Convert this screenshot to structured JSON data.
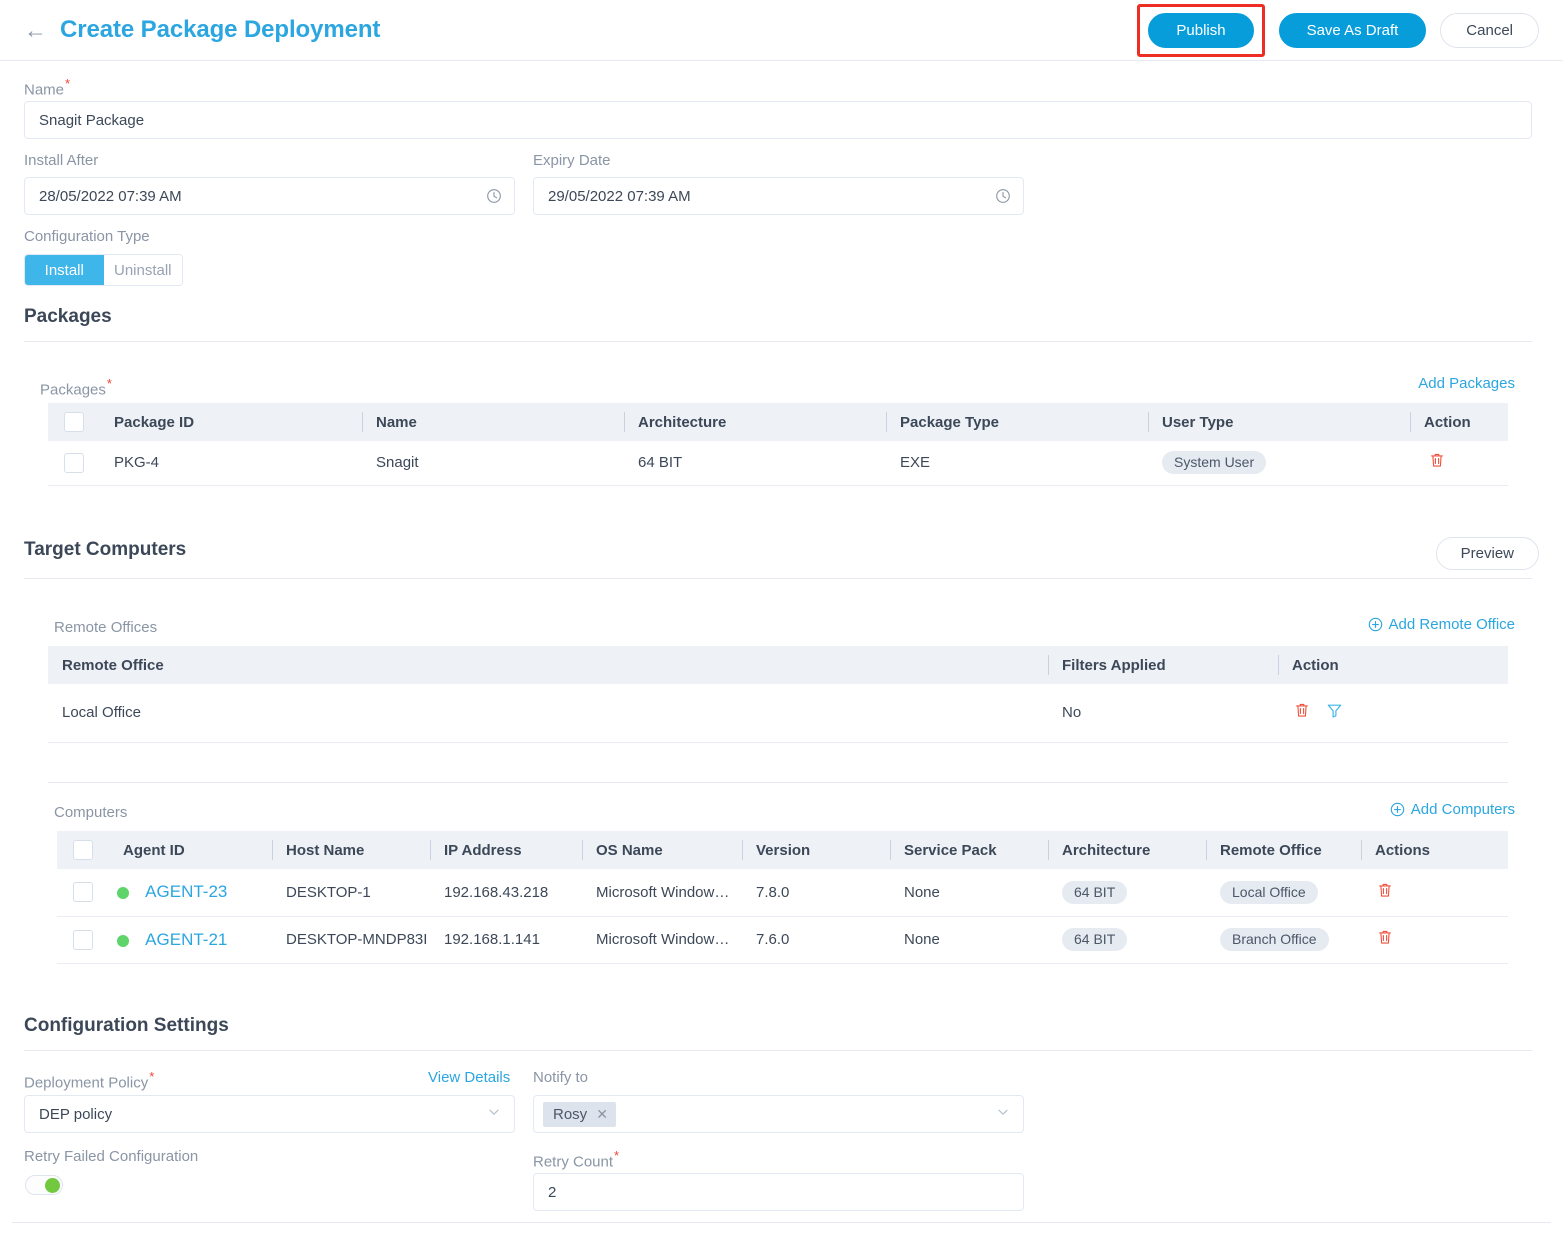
{
  "header": {
    "back_icon": "arrow-left-icon",
    "title": "Create Package Deployment",
    "publish_label": "Publish",
    "save_draft_label": "Save As Draft",
    "cancel_label": "Cancel",
    "accent_color": "#2ba6e0",
    "primary_button_color": "#079ddb",
    "highlight_color": "#ee2d24"
  },
  "form": {
    "name_label": "Name",
    "name_value": "Snagit Package",
    "install_after_label": "Install After",
    "install_after_value": "28/05/2022 07:39 AM",
    "expiry_date_label": "Expiry Date",
    "expiry_date_value": "29/05/2022 07:39 AM",
    "configuration_type_label": "Configuration Type",
    "config_install": "Install",
    "config_uninstall": "Uninstall",
    "config_selected": "Install"
  },
  "packages": {
    "section_title": "Packages",
    "sub_label": "Packages",
    "add_link": "Add Packages",
    "columns": [
      "Package ID",
      "Name",
      "Architecture",
      "Package Type",
      "User Type",
      "Action"
    ],
    "rows": [
      {
        "package_id": "PKG-4",
        "name": "Snagit",
        "architecture": "64 BIT",
        "package_type": "EXE",
        "user_type": "System User",
        "action_icon": "trash-icon"
      }
    ]
  },
  "target_computers": {
    "section_title": "Target Computers",
    "preview_label": "Preview",
    "remote_offices": {
      "sub_label": "Remote Offices",
      "add_link": "Add Remote Office",
      "columns": [
        "Remote Office",
        "Filters Applied",
        "Action"
      ],
      "rows": [
        {
          "remote_office": "Local Office",
          "filters_applied": "No",
          "action_icons": [
            "trash-icon",
            "filter-icon"
          ]
        }
      ]
    },
    "computers": {
      "sub_label": "Computers",
      "add_link": "Add Computers",
      "columns": [
        "Agent ID",
        "Host Name",
        "IP Address",
        "OS Name",
        "Version",
        "Service Pack",
        "Architecture",
        "Remote Office",
        "Actions"
      ],
      "rows": [
        {
          "status": "online",
          "agent_id": "AGENT-23",
          "host_name": "DESKTOP-1",
          "ip_address": "192.168.43.218",
          "os_name": "Microsoft Window…",
          "version": "7.8.0",
          "service_pack": "None",
          "architecture": "64 BIT",
          "remote_office": "Local Office",
          "action_icon": "trash-icon"
        },
        {
          "status": "online",
          "agent_id": "AGENT-21",
          "host_name": "DESKTOP-MNDP83I",
          "ip_address": "192.168.1.141",
          "os_name": "Microsoft Window…",
          "version": "7.6.0",
          "service_pack": "None",
          "architecture": "64 BIT",
          "remote_office": "Branch Office",
          "action_icon": "trash-icon"
        }
      ]
    }
  },
  "configuration_settings": {
    "section_title": "Configuration Settings",
    "deployment_policy_label": "Deployment Policy",
    "view_details_label": "View Details",
    "deployment_policy_value": "DEP policy",
    "notify_to_label": "Notify to",
    "notify_to_chip": "Rosy",
    "retry_failed_label": "Retry Failed Configuration",
    "retry_failed_on": true,
    "retry_count_label": "Retry Count",
    "retry_count_value": "2",
    "toggle_on_color": "#72c93f"
  }
}
